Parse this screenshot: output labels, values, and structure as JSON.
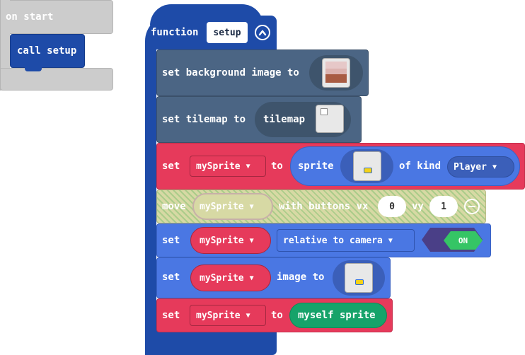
{
  "on_start": {
    "label": "on start"
  },
  "call_block": {
    "label": "call setup"
  },
  "function": {
    "keyword": "function",
    "name": "setup"
  },
  "blocks": {
    "bg": {
      "label": "set background image to"
    },
    "tilemap": {
      "label": "set tilemap to",
      "field": "tilemap"
    },
    "set_sprite": {
      "set": "set",
      "var": "mySprite",
      "to": "to",
      "sprite": "sprite",
      "of_kind": "of kind",
      "kind": "Player"
    },
    "move": {
      "move": "move",
      "var": "mySprite",
      "with": "with buttons vx",
      "vx": "0",
      "vy_label": "vy",
      "vy": "1"
    },
    "camera": {
      "set": "set",
      "var": "mySprite",
      "prop": "relative to camera",
      "toggle": "ON"
    },
    "image": {
      "set": "set",
      "var": "mySprite",
      "image_to": "image to"
    },
    "myself": {
      "set": "set",
      "var": "mySprite",
      "to": "to",
      "value": "myself sprite"
    }
  },
  "icons": {
    "collapse": "chevron-up",
    "remove": "minus",
    "dropdown": "caret-down"
  },
  "colors": {
    "function_blue": "#1e4ba8",
    "scene_slate": "#4b6584",
    "sprite_red": "#e63a5b",
    "sprite_blue": "#4a77e3",
    "controller_disabled": "#d7d9a4",
    "toggle_green": "#35c565"
  }
}
